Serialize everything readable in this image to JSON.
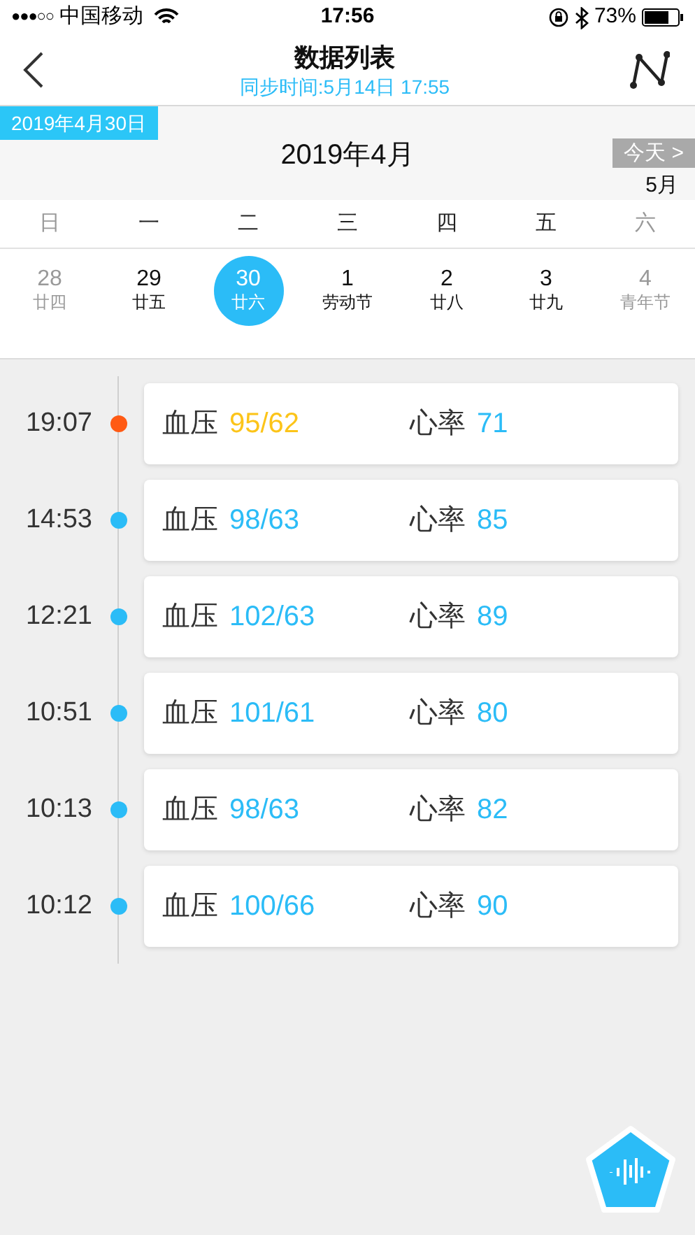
{
  "status_bar": {
    "signal": "●●●○○",
    "carrier": "中国移动",
    "time": "17:56",
    "battery": "73%"
  },
  "nav": {
    "title": "数据列表",
    "sync_time": "同步时间:5月14日 17:55"
  },
  "calendar": {
    "selected_date": "2019年4月30日",
    "month": "2019年4月",
    "today_button": "今天 >",
    "next_month": "5月",
    "weekdays": [
      {
        "label": "日",
        "weekend": true
      },
      {
        "label": "一",
        "weekend": false
      },
      {
        "label": "二",
        "weekend": false
      },
      {
        "label": "三",
        "weekend": false
      },
      {
        "label": "四",
        "weekend": false
      },
      {
        "label": "五",
        "weekend": false
      },
      {
        "label": "六",
        "weekend": true
      }
    ],
    "days": [
      {
        "day": "28",
        "lunar": "廿四",
        "weekend": true,
        "selected": false
      },
      {
        "day": "29",
        "lunar": "廿五",
        "weekend": false,
        "selected": false
      },
      {
        "day": "30",
        "lunar": "廿六",
        "weekend": false,
        "selected": true
      },
      {
        "day": "1",
        "lunar": "劳动节",
        "weekend": false,
        "selected": false
      },
      {
        "day": "2",
        "lunar": "廿八",
        "weekend": false,
        "selected": false
      },
      {
        "day": "3",
        "lunar": "廿九",
        "weekend": false,
        "selected": false
      },
      {
        "day": "4",
        "lunar": "青年节",
        "weekend": true,
        "selected": false
      }
    ]
  },
  "records": [
    {
      "time": "19:07",
      "color": "#ff5a14",
      "kind": "abnormal",
      "bp_label": "血压",
      "bp": "95/62",
      "hr_label": "心率",
      "hr": "71"
    },
    {
      "time": "14:53",
      "color": "#2bbcf7",
      "kind": "normal",
      "bp_label": "血压",
      "bp": "98/63",
      "hr_label": "心率",
      "hr": "85"
    },
    {
      "time": "12:21",
      "color": "#2bbcf7",
      "kind": "normal",
      "bp_label": "血压",
      "bp": "102/63",
      "hr_label": "心率",
      "hr": "89"
    },
    {
      "time": "10:51",
      "color": "#2bbcf7",
      "kind": "normal",
      "bp_label": "血压",
      "bp": "101/61",
      "hr_label": "心率",
      "hr": "80"
    },
    {
      "time": "10:13",
      "color": "#2bbcf7",
      "kind": "normal",
      "bp_label": "血压",
      "bp": "98/63",
      "hr_label": "心率",
      "hr": "82"
    },
    {
      "time": "10:12",
      "color": "#2bbcf7",
      "kind": "normal",
      "bp_label": "血压",
      "bp": "100/66",
      "hr_label": "心率",
      "hr": "90"
    }
  ]
}
